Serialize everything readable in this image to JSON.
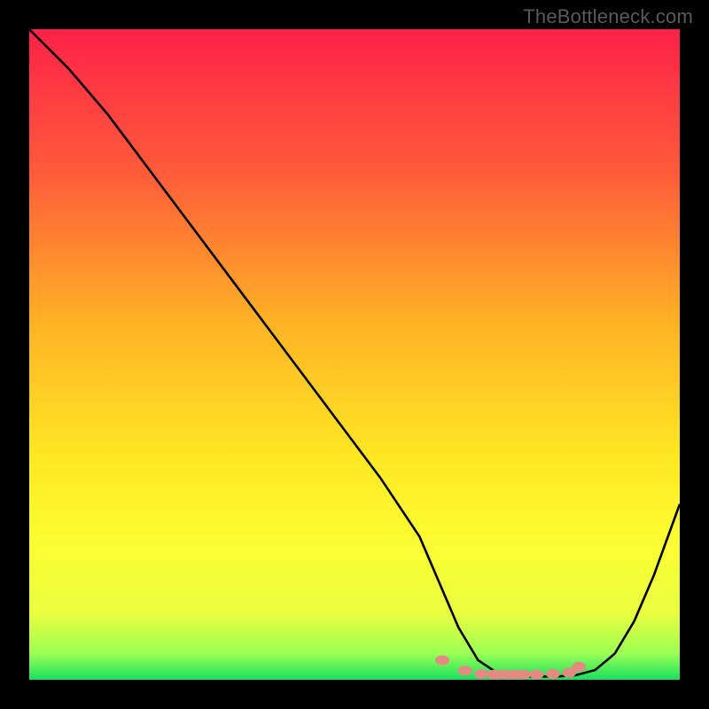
{
  "watermark": "TheBottleneck.com",
  "chart_data": {
    "type": "line",
    "title": "",
    "xlabel": "",
    "ylabel": "",
    "xlim": [
      0,
      100
    ],
    "ylim": [
      0,
      100
    ],
    "grid": false,
    "legend": false,
    "gradient_bg": {
      "stops": [
        {
          "offset": 0,
          "color": "#ff2149"
        },
        {
          "offset": 22,
          "color": "#ff5b3a"
        },
        {
          "offset": 45,
          "color": "#ffb225"
        },
        {
          "offset": 65,
          "color": "#ffe623"
        },
        {
          "offset": 80,
          "color": "#fbff33"
        },
        {
          "offset": 90,
          "color": "#e8ff3f"
        },
        {
          "offset": 96,
          "color": "#9bff55"
        },
        {
          "offset": 100,
          "color": "#17e05e"
        }
      ]
    },
    "series": [
      {
        "name": "bottleneck-curve",
        "color": "#000000",
        "x": [
          0,
          6,
          12,
          18,
          24,
          30,
          36,
          42,
          48,
          54,
          60,
          63,
          66,
          69,
          72,
          75,
          78,
          81,
          84,
          87,
          90,
          93,
          96,
          100
        ],
        "y": [
          100,
          94,
          87,
          79,
          71,
          63,
          55,
          47,
          39,
          31,
          22,
          15,
          8,
          3,
          1,
          0.5,
          0.5,
          0.5,
          0.7,
          1.5,
          4,
          9,
          16,
          27
        ]
      },
      {
        "name": "optimal-dots",
        "type": "scatter",
        "color": "#e58a82",
        "x": [
          63.5,
          67,
          69.5,
          71.5,
          73,
          74.5,
          76,
          78,
          80.5,
          83,
          84.5
        ],
        "y": [
          3.0,
          1.4,
          0.9,
          0.8,
          0.8,
          0.8,
          0.8,
          0.8,
          0.9,
          1.1,
          2.0
        ]
      }
    ]
  }
}
